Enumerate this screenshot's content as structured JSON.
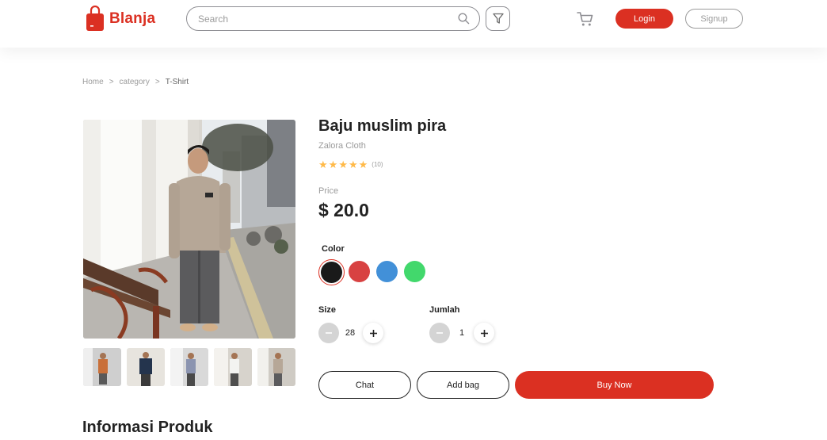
{
  "header": {
    "brand": "Blanja",
    "search_placeholder": "Search",
    "login_label": "Login",
    "signup_label": "Signup",
    "icons": [
      "shopping-bag-logo-icon",
      "search-icon",
      "filter-icon",
      "cart-icon"
    ]
  },
  "breadcrumb": [
    "Home",
    ">",
    "category",
    ">",
    "T-Shirt"
  ],
  "product": {
    "name": "Baju muslim pira",
    "store": "Zalora Cloth",
    "rating_stars": 5,
    "rating_count": "(10)",
    "price_label": "Price",
    "price": "$ 20.0",
    "color_label": "Color",
    "colors": [
      "#1A1A1A",
      "#D84242",
      "#4290D8",
      "#42D86C"
    ],
    "selected_color": 0,
    "size_label": "Size",
    "size_value": "28",
    "qty_label": "Jumlah",
    "qty_value": "1"
  },
  "actions": {
    "chat": "Chat",
    "add_bag": "Add bag",
    "buy_now": "Buy Now"
  },
  "section": {
    "info_title": "Informasi Produk"
  }
}
